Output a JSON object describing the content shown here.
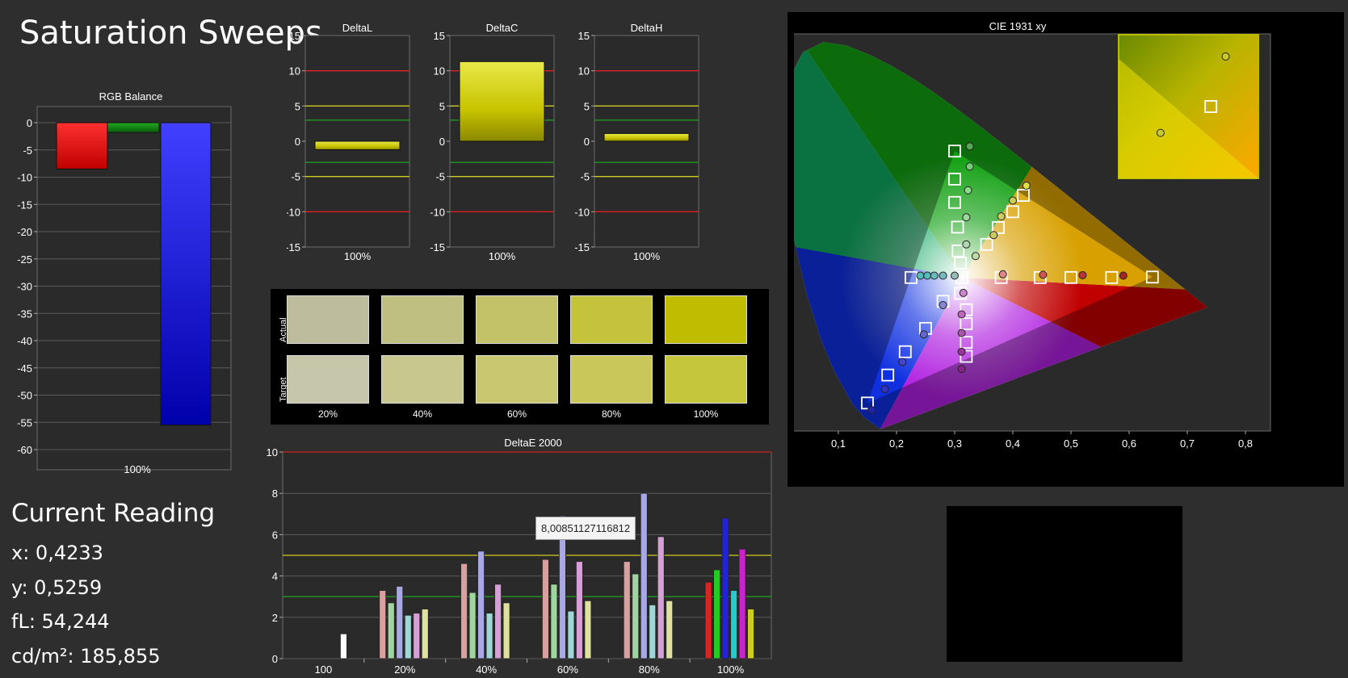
{
  "page_title": "Saturation Sweeps",
  "current_reading": {
    "header": "Current Reading",
    "x": "x: 0,4233",
    "y": "y: 0,5259",
    "fl": "fL: 54,244",
    "cdm2": "cd/m²: 185,855"
  },
  "tooltip": "8,00851127116812",
  "swatches": {
    "row_actual": "Actual",
    "row_target": "Target",
    "labels": [
      "20%",
      "40%",
      "60%",
      "80%",
      "100%"
    ],
    "actual_colors": [
      "#bdbc9c",
      "#c0bf82",
      "#c4c269",
      "#c5c23c",
      "#c0bd00"
    ],
    "target_colors": [
      "#c6c6aa",
      "#c8c88e",
      "#c9c870",
      "#c9c75a",
      "#c6c63c"
    ]
  },
  "chart_data": [
    {
      "id": "rgb_balance",
      "type": "bar",
      "title": "RGB Balance",
      "categories": [
        "100%"
      ],
      "series": [
        {
          "color": "red",
          "values": [
            -8.5
          ]
        },
        {
          "color": "green",
          "values": [
            -1.8
          ]
        },
        {
          "color": "blue",
          "values": [
            -55.5
          ]
        }
      ],
      "ylim": [
        -60,
        0
      ],
      "yticks": [
        "0",
        "-5",
        "-10",
        "-15",
        "-20",
        "-25",
        "-30",
        "-35",
        "-40",
        "-45",
        "-50",
        "-55",
        "-60"
      ]
    },
    {
      "id": "delta_l",
      "type": "bar",
      "title": "DeltaL",
      "categories": [
        "100%"
      ],
      "values": [
        -1.2
      ],
      "ylim": [
        -15,
        15
      ],
      "yticks": [
        "15",
        "10",
        "5",
        "0",
        "-5",
        "-10",
        "-15"
      ]
    },
    {
      "id": "delta_c",
      "type": "bar",
      "title": "DeltaC",
      "categories": [
        "100%"
      ],
      "values": [
        11.3
      ],
      "ylim": [
        -15,
        15
      ],
      "yticks": [
        "15",
        "10",
        "5",
        "0",
        "-5",
        "-10",
        "-15"
      ]
    },
    {
      "id": "delta_h",
      "type": "bar",
      "title": "DeltaH",
      "categories": [
        "100%"
      ],
      "values": [
        1.1
      ],
      "ylim": [
        -15,
        15
      ],
      "yticks": [
        "15",
        "10",
        "5",
        "0",
        "-5",
        "-10",
        "-15"
      ]
    },
    {
      "id": "delta_e",
      "type": "bar",
      "title": "DeltaE 2000",
      "categories": [
        "100",
        "20%",
        "40%",
        "60%",
        "80%",
        "100%"
      ],
      "ylim": [
        0,
        10
      ],
      "yticks": [
        "10",
        "8",
        "6",
        "4",
        "2",
        "0"
      ],
      "reference_lines": [
        5,
        3
      ],
      "groups": [
        [
          0,
          0,
          0,
          0,
          0,
          1.2
        ],
        [
          3.3,
          2.7,
          3.5,
          2.1,
          2.2,
          2.4
        ],
        [
          4.6,
          3.2,
          5.2,
          2.2,
          3.6,
          2.7
        ],
        [
          4.8,
          3.6,
          6.9,
          2.3,
          4.7,
          2.8
        ],
        [
          4.7,
          4.1,
          8.0,
          2.6,
          5.9,
          2.8
        ],
        [
          3.7,
          4.3,
          6.8,
          3.3,
          5.3,
          2.4
        ]
      ],
      "series_colors": [
        "#d9a0a0",
        "#9fd69f",
        "#a8a8e6",
        "#9fd6d6",
        "#d6a0d6",
        "#e0e0a0"
      ],
      "last_group_colors": [
        "#dd2222",
        "#22cc22",
        "#2222dd",
        "#22cccc",
        "#cc22cc",
        "#cccc22"
      ],
      "first_group_bar_color": "#ffffff"
    },
    {
      "id": "cie",
      "type": "scatter",
      "title": "CIE 1931 xy",
      "xlim": [
        0,
        0.85
      ],
      "ylim": [
        0,
        0.85
      ],
      "xticks": [
        "0",
        "0,1",
        "0,2",
        "0,3",
        "0,4",
        "0,5",
        "0,6",
        "0,7",
        "0,8"
      ],
      "yticks": [
        "0",
        "0,1",
        "0,2",
        "0,3",
        "0,4",
        "0,5",
        "0,6",
        "0,7",
        "0,8"
      ],
      "targets": [
        [
          0.3127,
          0.329
        ],
        [
          0.3,
          0.6
        ],
        [
          0.3,
          0.54
        ],
        [
          0.3,
          0.49
        ],
        [
          0.305,
          0.437
        ],
        [
          0.306,
          0.386
        ],
        [
          0.31,
          0.36
        ],
        [
          0.355,
          0.4
        ],
        [
          0.375,
          0.436
        ],
        [
          0.4,
          0.47
        ],
        [
          0.418,
          0.505
        ],
        [
          0.225,
          0.329
        ],
        [
          0.38,
          0.329
        ],
        [
          0.447,
          0.329
        ],
        [
          0.5,
          0.329
        ],
        [
          0.57,
          0.329
        ],
        [
          0.64,
          0.33
        ],
        [
          0.31,
          0.295
        ],
        [
          0.32,
          0.26
        ],
        [
          0.32,
          0.23
        ],
        [
          0.32,
          0.19
        ],
        [
          0.32,
          0.16
        ],
        [
          0.28,
          0.278
        ],
        [
          0.25,
          0.22
        ],
        [
          0.215,
          0.17
        ],
        [
          0.185,
          0.12
        ],
        [
          0.15,
          0.06
        ]
      ],
      "measured": [
        [
          0.326,
          0.61,
          "#55aa55"
        ],
        [
          0.326,
          0.567,
          "#77cc77"
        ],
        [
          0.323,
          0.516,
          "#88dd88"
        ],
        [
          0.32,
          0.458,
          "#99dd99"
        ],
        [
          0.32,
          0.4,
          "#aaddaa"
        ],
        [
          0.336,
          0.375,
          "#bbddaa"
        ],
        [
          0.367,
          0.42,
          "#cccc66"
        ],
        [
          0.38,
          0.46,
          "#cccc66"
        ],
        [
          0.4,
          0.494,
          "#cccc55"
        ],
        [
          0.4233,
          0.5259,
          "#dddd44"
        ],
        [
          0.241,
          0.333,
          "#55bbbb"
        ],
        [
          0.253,
          0.333,
          "#55bbbb"
        ],
        [
          0.265,
          0.333,
          "#66bbbb"
        ],
        [
          0.28,
          0.333,
          "#77bbbb"
        ],
        [
          0.3,
          0.333,
          "#99bbbb"
        ],
        [
          0.383,
          0.336,
          "#dd8888"
        ],
        [
          0.452,
          0.335,
          "#cc5555"
        ],
        [
          0.52,
          0.334,
          "#bb3333"
        ],
        [
          0.59,
          0.333,
          "#aa2222"
        ],
        [
          0.315,
          0.296,
          "#cc88cc"
        ],
        [
          0.312,
          0.25,
          "#bb66bb"
        ],
        [
          0.312,
          0.21,
          "#aa55aa"
        ],
        [
          0.312,
          0.17,
          "#993399"
        ],
        [
          0.312,
          0.133,
          "#882288"
        ],
        [
          0.28,
          0.27,
          "#8888cc"
        ],
        [
          0.247,
          0.207,
          "#6666cc"
        ],
        [
          0.21,
          0.148,
          "#4444cc"
        ],
        [
          0.18,
          0.09,
          "#3333bb"
        ],
        [
          0.157,
          0.045,
          "#2222aa"
        ]
      ],
      "inset_points": [
        {
          "kind": "measured",
          "x": 0.4233,
          "y": 0.5259
        },
        {
          "kind": "target",
          "x": 0.418,
          "y": 0.505
        },
        {
          "kind": "measured",
          "x": 0.4,
          "y": 0.494
        }
      ]
    }
  ]
}
